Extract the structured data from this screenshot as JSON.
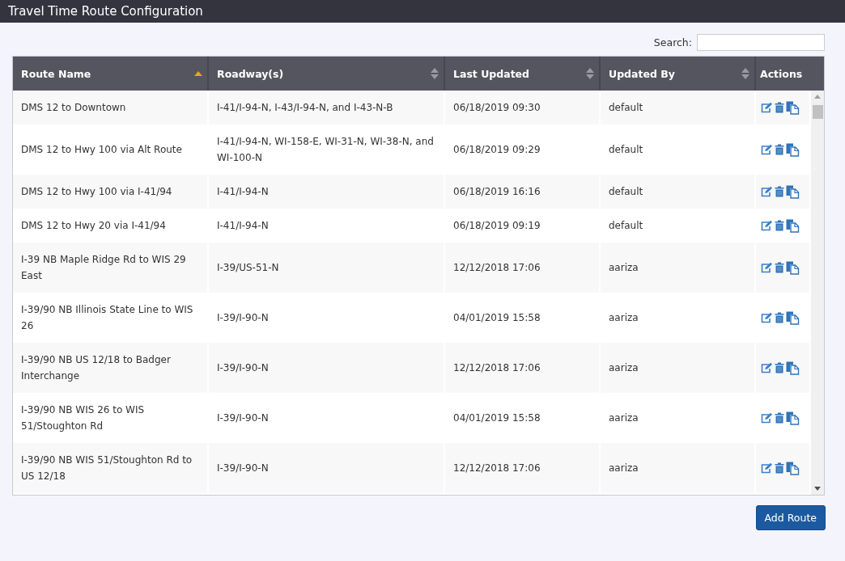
{
  "window": {
    "title": "Travel Time Route Configuration"
  },
  "search": {
    "label": "Search:"
  },
  "table": {
    "columns": [
      {
        "label": "Route Name",
        "sortable": true,
        "sorted_ascending": true
      },
      {
        "label": "Roadway(s)",
        "sortable": true,
        "sorted_ascending": false
      },
      {
        "label": "Last Updated",
        "sortable": true,
        "sorted_ascending": false
      },
      {
        "label": "Updated By",
        "sortable": true,
        "sorted_ascending": false
      },
      {
        "label": "Actions",
        "sortable": false
      }
    ],
    "rows": [
      {
        "route_name": "DMS 12 to Downtown",
        "roadways": "I-41/I-94-N, I-43/I-94-N, and I-43-N-B",
        "last_updated": "06/18/2019 09:30",
        "updated_by": "default"
      },
      {
        "route_name": "DMS 12 to Hwy 100 via Alt Route",
        "roadways": "I-41/I-94-N, WI-158-E, WI-31-N, WI-38-N, and WI-100-N",
        "last_updated": "06/18/2019 09:29",
        "updated_by": "default"
      },
      {
        "route_name": "DMS 12 to Hwy 100 via I-41/94",
        "roadways": "I-41/I-94-N",
        "last_updated": "06/18/2019 16:16",
        "updated_by": "default"
      },
      {
        "route_name": "DMS 12 to Hwy 20 via I-41/94",
        "roadways": "I-41/I-94-N",
        "last_updated": "06/18/2019 09:19",
        "updated_by": "default"
      },
      {
        "route_name": "I-39 NB Maple Ridge Rd to WIS 29 East",
        "roadways": "I-39/US-51-N",
        "last_updated": "12/12/2018 17:06",
        "updated_by": "aariza"
      },
      {
        "route_name": "I-39/90 NB Illinois State Line to WIS 26",
        "roadways": "I-39/I-90-N",
        "last_updated": "04/01/2019 15:58",
        "updated_by": "aariza"
      },
      {
        "route_name": "I-39/90 NB US 12/18 to Badger Interchange",
        "roadways": "I-39/I-90-N",
        "last_updated": "12/12/2018 17:06",
        "updated_by": "aariza"
      },
      {
        "route_name": "I-39/90 NB WIS 26 to WIS 51/Stoughton Rd",
        "roadways": "I-39/I-90-N",
        "last_updated": "04/01/2019 15:58",
        "updated_by": "aariza"
      },
      {
        "route_name": "I-39/90 NB WIS 51/Stoughton Rd to US 12/18",
        "roadways": "I-39/I-90-N",
        "last_updated": "12/12/2018 17:06",
        "updated_by": "aariza"
      }
    ]
  },
  "buttons": [
    {
      "label": "Add Route"
    }
  ]
}
